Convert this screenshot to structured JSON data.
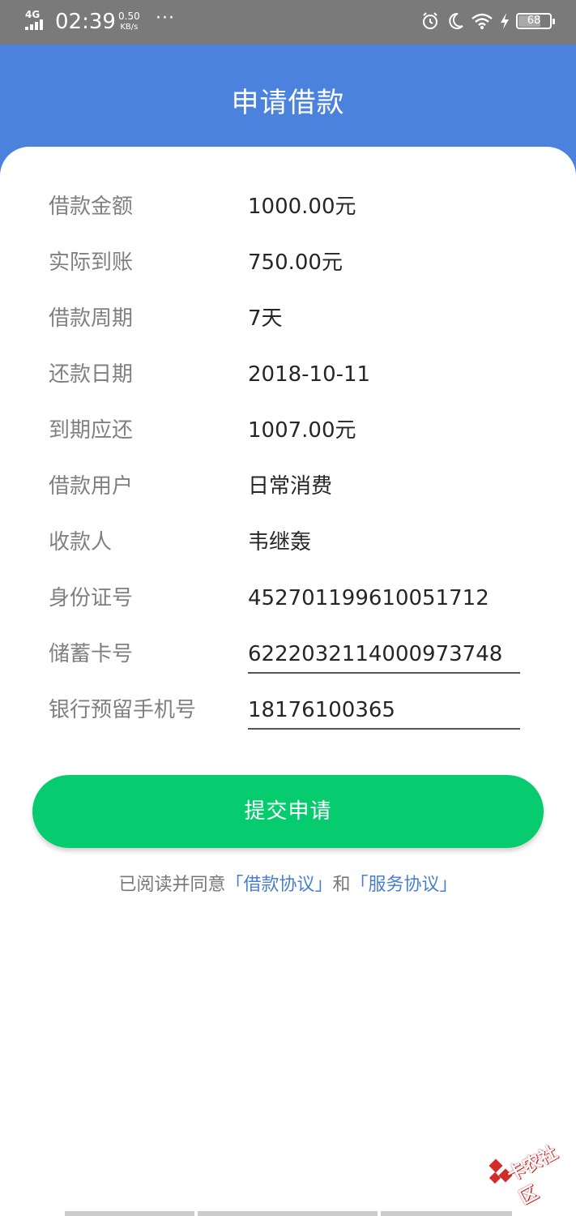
{
  "status_bar": {
    "network": "4G",
    "time": "02:39",
    "speed_value": "0.50",
    "speed_unit": "KB/s",
    "more": "···",
    "battery": "68",
    "battery_level": 0.68
  },
  "header": {
    "title": "申请借款"
  },
  "rows": [
    {
      "label": "借款金额",
      "value": "1000.00元"
    },
    {
      "label": "实际到账",
      "value": "750.00元"
    },
    {
      "label": "借款周期",
      "value": "7天"
    },
    {
      "label": "还款日期",
      "value": "2018-10-11"
    },
    {
      "label": "到期应还",
      "value": "1007.00元"
    },
    {
      "label": "借款用户",
      "value": "日常消费"
    },
    {
      "label": "收款人",
      "value": "韦继轰"
    },
    {
      "label": "身份证号",
      "value": "452701199610051712"
    },
    {
      "label": "储蓄卡号",
      "value": "6222032114000973748"
    },
    {
      "label": "银行预留手机号",
      "value": "18176100365"
    }
  ],
  "submit_label": "提交申请",
  "agreement": {
    "prefix": "已阅读并同意",
    "loan_link": "「借款协议」",
    "conj": "和",
    "service_link": "「服务协议」"
  },
  "watermark": "卡农社区"
}
